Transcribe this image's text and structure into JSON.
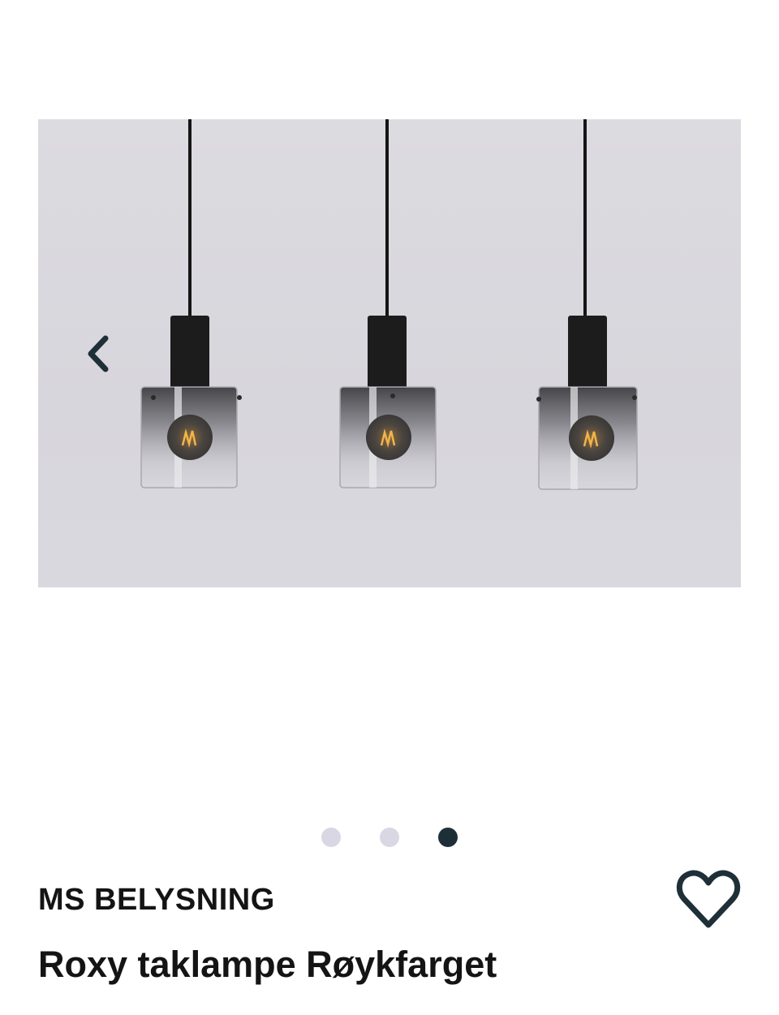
{
  "gallery": {
    "image_alt": "Roxy taklampe Røykfarget",
    "prev_icon": "chevron-left-icon",
    "slide_count": 3,
    "active_slide": 3
  },
  "product": {
    "brand": "MS BELYSNING",
    "title": "Roxy taklampe Røykfarget",
    "favorite_icon": "heart-outline-icon"
  },
  "colors": {
    "accent": "#1e2f38",
    "dot_inactive": "#d9d7e4",
    "text": "#141414",
    "image_background": "#d8d7dd"
  }
}
